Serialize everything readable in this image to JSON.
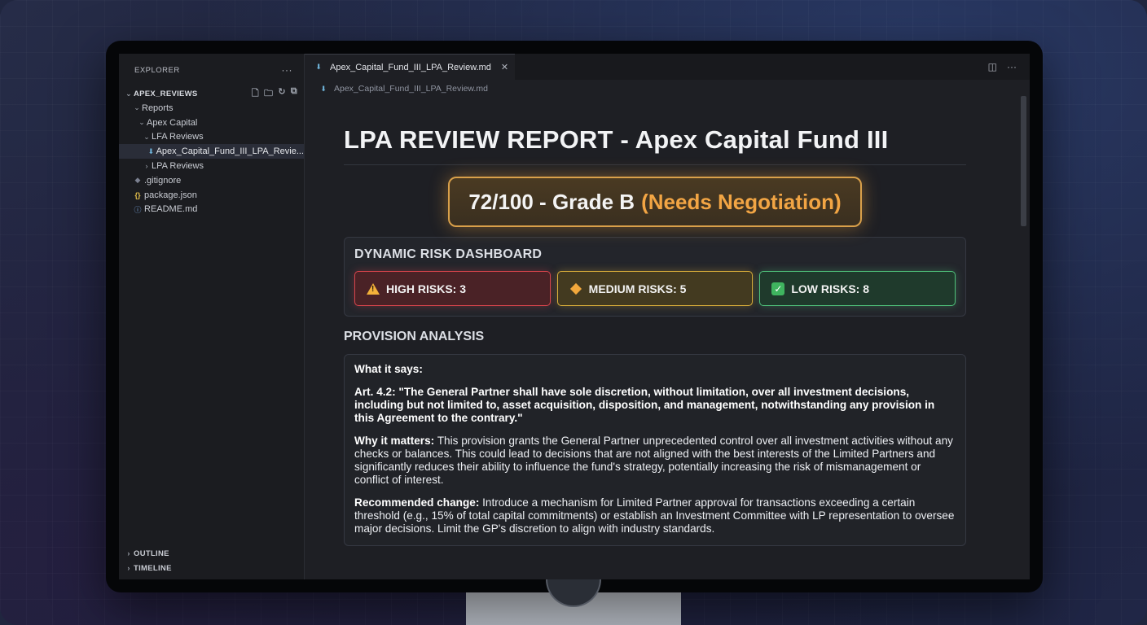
{
  "sidebar": {
    "title": "EXPLORER",
    "more": "···",
    "root": "APEX_REVIEWS",
    "items": [
      {
        "label": "Reports"
      },
      {
        "label": "Apex Capital"
      },
      {
        "label": "LFA Reviews"
      },
      {
        "label": "Apex_Capital_Fund_III_LPA_Revie..."
      },
      {
        "label": "LPA Reviews"
      },
      {
        "label": ".gitignore"
      },
      {
        "label": "package.json"
      },
      {
        "label": "README.md"
      }
    ],
    "outline": "OUTLINE",
    "timeline": "TIMELINE"
  },
  "editor": {
    "tab_label": "Apex_Capital_Fund_III_LPA_Review.md",
    "breadcrumb": "Apex_Capital_Fund_III_LPA_Review.md"
  },
  "doc": {
    "title": "LPA REVIEW REPORT - Apex Capital Fund III",
    "grade_score": "72/100 - Grade B",
    "grade_status": "(Needs Negotiation)",
    "dashboard_title": "DYNAMIC RISK DASHBOARD",
    "high_risks": "HIGH RISKS: 3",
    "medium_risks": "MEDIUM RISKS: 5",
    "low_risks": "LOW RISKS: 8",
    "provision_title": "PROVISION ANALYSIS",
    "what_label": "What it says:",
    "article": "Art. 4.2: \"The General Partner shall have sole discretion, without limitation, over all investment decisions, including but not limited to, asset acquisition, disposition, and management, notwithstanding any provision in this Agreement to the contrary.\"",
    "why_label": "Why it matters:",
    "why_text": " This provision grants the General Partner unprecedented control over all investment activities without any checks or balances. This could lead to decisions that are not aligned with the best interests of the Limited Partners and significantly reduces their ability to influence the fund's strategy, potentially increasing the risk of mismanagement or conflict of interest.",
    "rec_label": "Recommended change:",
    "rec_text": " Introduce a mechanism for Limited Partner approval for transactions exceeding a certain threshold (e.g., 15% of total capital commitments) or establish an Investment Committee with LP representation to oversee major decisions. Limit the GP's discretion to align with industry standards."
  },
  "colors": {
    "grade_status": "#f2a544",
    "high": "#d8444c",
    "medium": "#d8ad3a",
    "low": "#4fc17a"
  }
}
